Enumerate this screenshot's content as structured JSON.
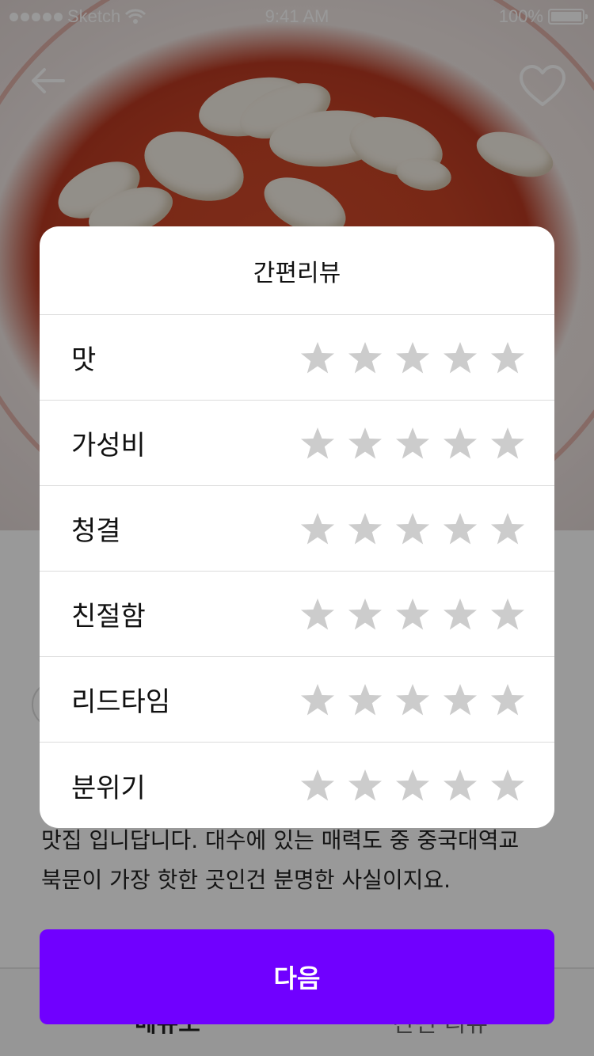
{
  "status_bar": {
    "carrier": "Sketch",
    "time": "9:41 AM",
    "battery": "100%",
    "battery_level": 1.0
  },
  "nav": {
    "back_icon": "arrow-left-icon",
    "favorite_icon": "heart-outline-icon"
  },
  "background_page": {
    "description_line1": "맛집 입니답니다. 대수에 있는 매력도 중 중국대역교",
    "description_line2": "북문이 가장 핫한 곳인건 분명한 사실이지요.",
    "tabs": [
      "메뉴소",
      "간편 리뷰"
    ]
  },
  "modal": {
    "title": "간편리뷰",
    "star_max": 5,
    "star_color_empty": "#cccccc",
    "rows": [
      {
        "label": "맛",
        "rating": 0
      },
      {
        "label": "가성비",
        "rating": 0
      },
      {
        "label": "청결",
        "rating": 0
      },
      {
        "label": "친절함",
        "rating": 0
      },
      {
        "label": "리드타임",
        "rating": 0
      },
      {
        "label": "분위기",
        "rating": 0
      }
    ]
  },
  "next_button": {
    "label": "다음",
    "color": "#7000ff"
  }
}
